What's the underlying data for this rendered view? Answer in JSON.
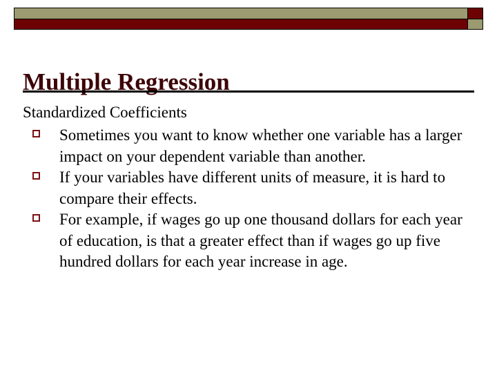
{
  "slide": {
    "title": "Multiple Regression",
    "banner": {
      "olive_color": "#9b9a70",
      "maroon_color": "#6d0205",
      "outline_color": "#000000"
    },
    "title_color": "#3d0508",
    "rule_color": "#000000",
    "lead_text": "Standardized Coefficients",
    "bullet_marker_glyph": "o",
    "bullet_marker_color": "#7b1113",
    "bullets": [
      {
        "text": "Sometimes you want to know whether one variable has a larger impact on your dependent variable than another."
      },
      {
        "text": "If your variables have different units of measure, it is hard to compare their effects."
      },
      {
        "text": "For example, if wages go up one thousand dollars for each year of education, is that a greater effect than if wages go up five hundred dollars for each year increase in age."
      }
    ]
  }
}
